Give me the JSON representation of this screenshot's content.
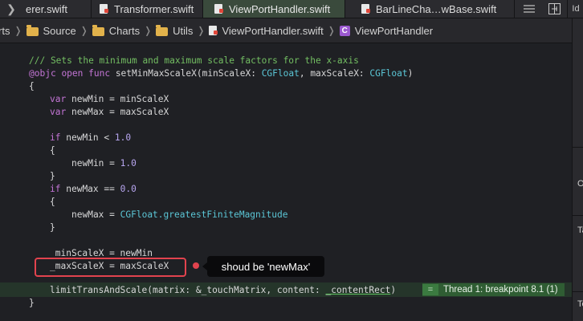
{
  "tabs": [
    {
      "label": "erer.swift",
      "active": false
    },
    {
      "label": "Transformer.swift",
      "active": false
    },
    {
      "label": "ViewPortHandler.swift",
      "active": true
    },
    {
      "label": "BarLineCha…wBase.swift",
      "active": false
    }
  ],
  "toolbar": {
    "back_icon": "chevron-left-icon",
    "list_icon": "list-icon",
    "split_icon": "split-editor-icon",
    "add_icon": "add-editor-icon"
  },
  "breadcrumb": {
    "items": [
      "rts",
      "Source",
      "Charts",
      "Utils",
      "ViewPortHandler.swift",
      "ViewPortHandler"
    ],
    "class_badge": "C"
  },
  "code": {
    "l1": "/// Sets the minimum and maximum scale factors for the x-axis",
    "l2_attr": "@objc",
    "l2_kw": "open func",
    "l2_name": "setMinMaxScaleX(minScaleX:",
    "l2_type1": "CGFloat",
    "l2_mid": ", maxScaleX:",
    "l2_type2": "CGFloat",
    "l2_end": ")",
    "brace_open": "{",
    "brace_close": "}",
    "var": "var",
    "if": "if",
    "l4_rest": "newMin = minScaleX",
    "l5_rest": "newMax = maxScaleX",
    "l7_rest_a": "newMin",
    "l7_op": "<",
    "l7_num": "1.0",
    "l9_rest": "newMin =",
    "l9_num": "1.0",
    "l11_rest_a": "newMax",
    "l11_op": "==",
    "l11_num": "0.0",
    "l13_rest": "newMax =",
    "l13_type": "CGFloat",
    "l13_member": ".greatestFiniteMagnitude",
    "l16": "_minScaleX = newMin",
    "l17": "_maxScaleX = maxScaleX",
    "l19_a": "limitTransAndScale(matrix: &_touchMatrix, content:",
    "l19_b": "_contentRect",
    "l19_c": ")"
  },
  "annotation": {
    "text": "shoud be 'newMax'",
    "color": "#e2434e"
  },
  "breakpoint": {
    "eq": "=",
    "label": "Thread 1: breakpoint 8.1 (1)",
    "color": "#2f5d33"
  },
  "inspector": {
    "labels": [
      "Id",
      "O",
      "Ta",
      "Te"
    ]
  }
}
